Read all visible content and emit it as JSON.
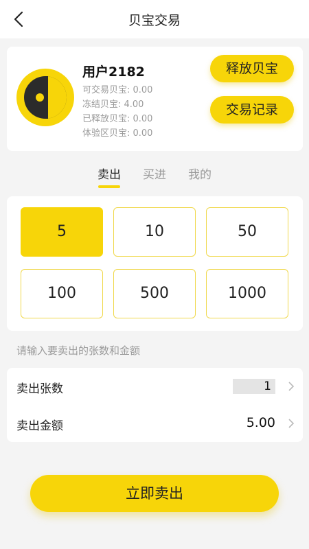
{
  "header": {
    "title": "贝宝交易",
    "back_icon": "back-arrow-icon"
  },
  "user": {
    "name": "用户2182",
    "stats": [
      "可交易贝宝: 0.00",
      "冻结贝宝: 4.00",
      "已释放贝宝: 0.00",
      "体验区贝宝: 0.00"
    ],
    "release_button": "释放贝宝",
    "records_button": "交易记录",
    "avatar_icon": "logo-avatar-icon"
  },
  "tabs": [
    {
      "label": "卖出",
      "active": true
    },
    {
      "label": "买进",
      "active": false
    },
    {
      "label": "我的",
      "active": false
    }
  ],
  "options": [
    {
      "label": "5",
      "selected": true
    },
    {
      "label": "10",
      "selected": false
    },
    {
      "label": "50",
      "selected": false
    },
    {
      "label": "100",
      "selected": false
    },
    {
      "label": "500",
      "selected": false
    },
    {
      "label": "1000",
      "selected": false
    }
  ],
  "hint": "请输入要卖出的张数和金额",
  "form": {
    "count_label": "卖出张数",
    "count_value": "1",
    "amount_label": "卖出金额",
    "amount_value": "5.00"
  },
  "submit_label": "立即卖出",
  "colors": {
    "accent": "#f7d509",
    "background": "#f4f4f4",
    "muted_text": "#9a9a9a"
  }
}
